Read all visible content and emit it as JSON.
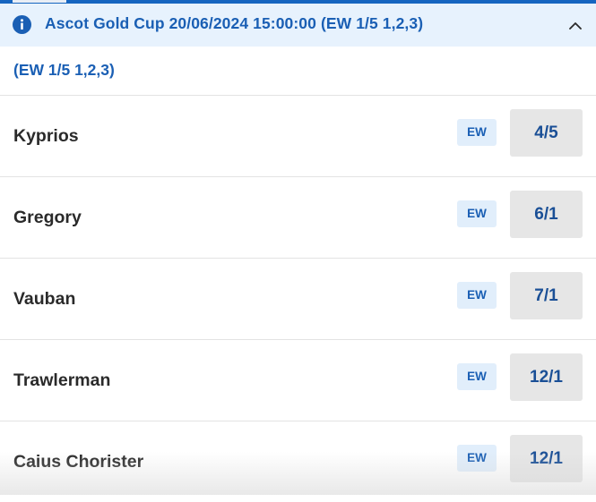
{
  "colors": {
    "accent": "#1a5fb4",
    "header_bg": "#e7f2fd",
    "odds_bg": "#e6e6e6",
    "ew_bg": "#e1eefb",
    "text": "#2a2a2a"
  },
  "market": {
    "info_icon": "info-icon",
    "title": "Ascot Gold Cup 20/06/2024 15:00:00 (EW 1/5 1,2,3)",
    "collapse_icon": "chevron-up-icon",
    "terms": "(EW 1/5 1,2,3)"
  },
  "runners": [
    {
      "name": "Kyprios",
      "badge": "EW",
      "odds": "4/5"
    },
    {
      "name": "Gregory",
      "badge": "EW",
      "odds": "6/1"
    },
    {
      "name": "Vauban",
      "badge": "EW",
      "odds": "7/1"
    },
    {
      "name": "Trawlerman",
      "badge": "EW",
      "odds": "12/1"
    },
    {
      "name": "Caius Chorister",
      "badge": "EW",
      "odds": "12/1"
    }
  ]
}
